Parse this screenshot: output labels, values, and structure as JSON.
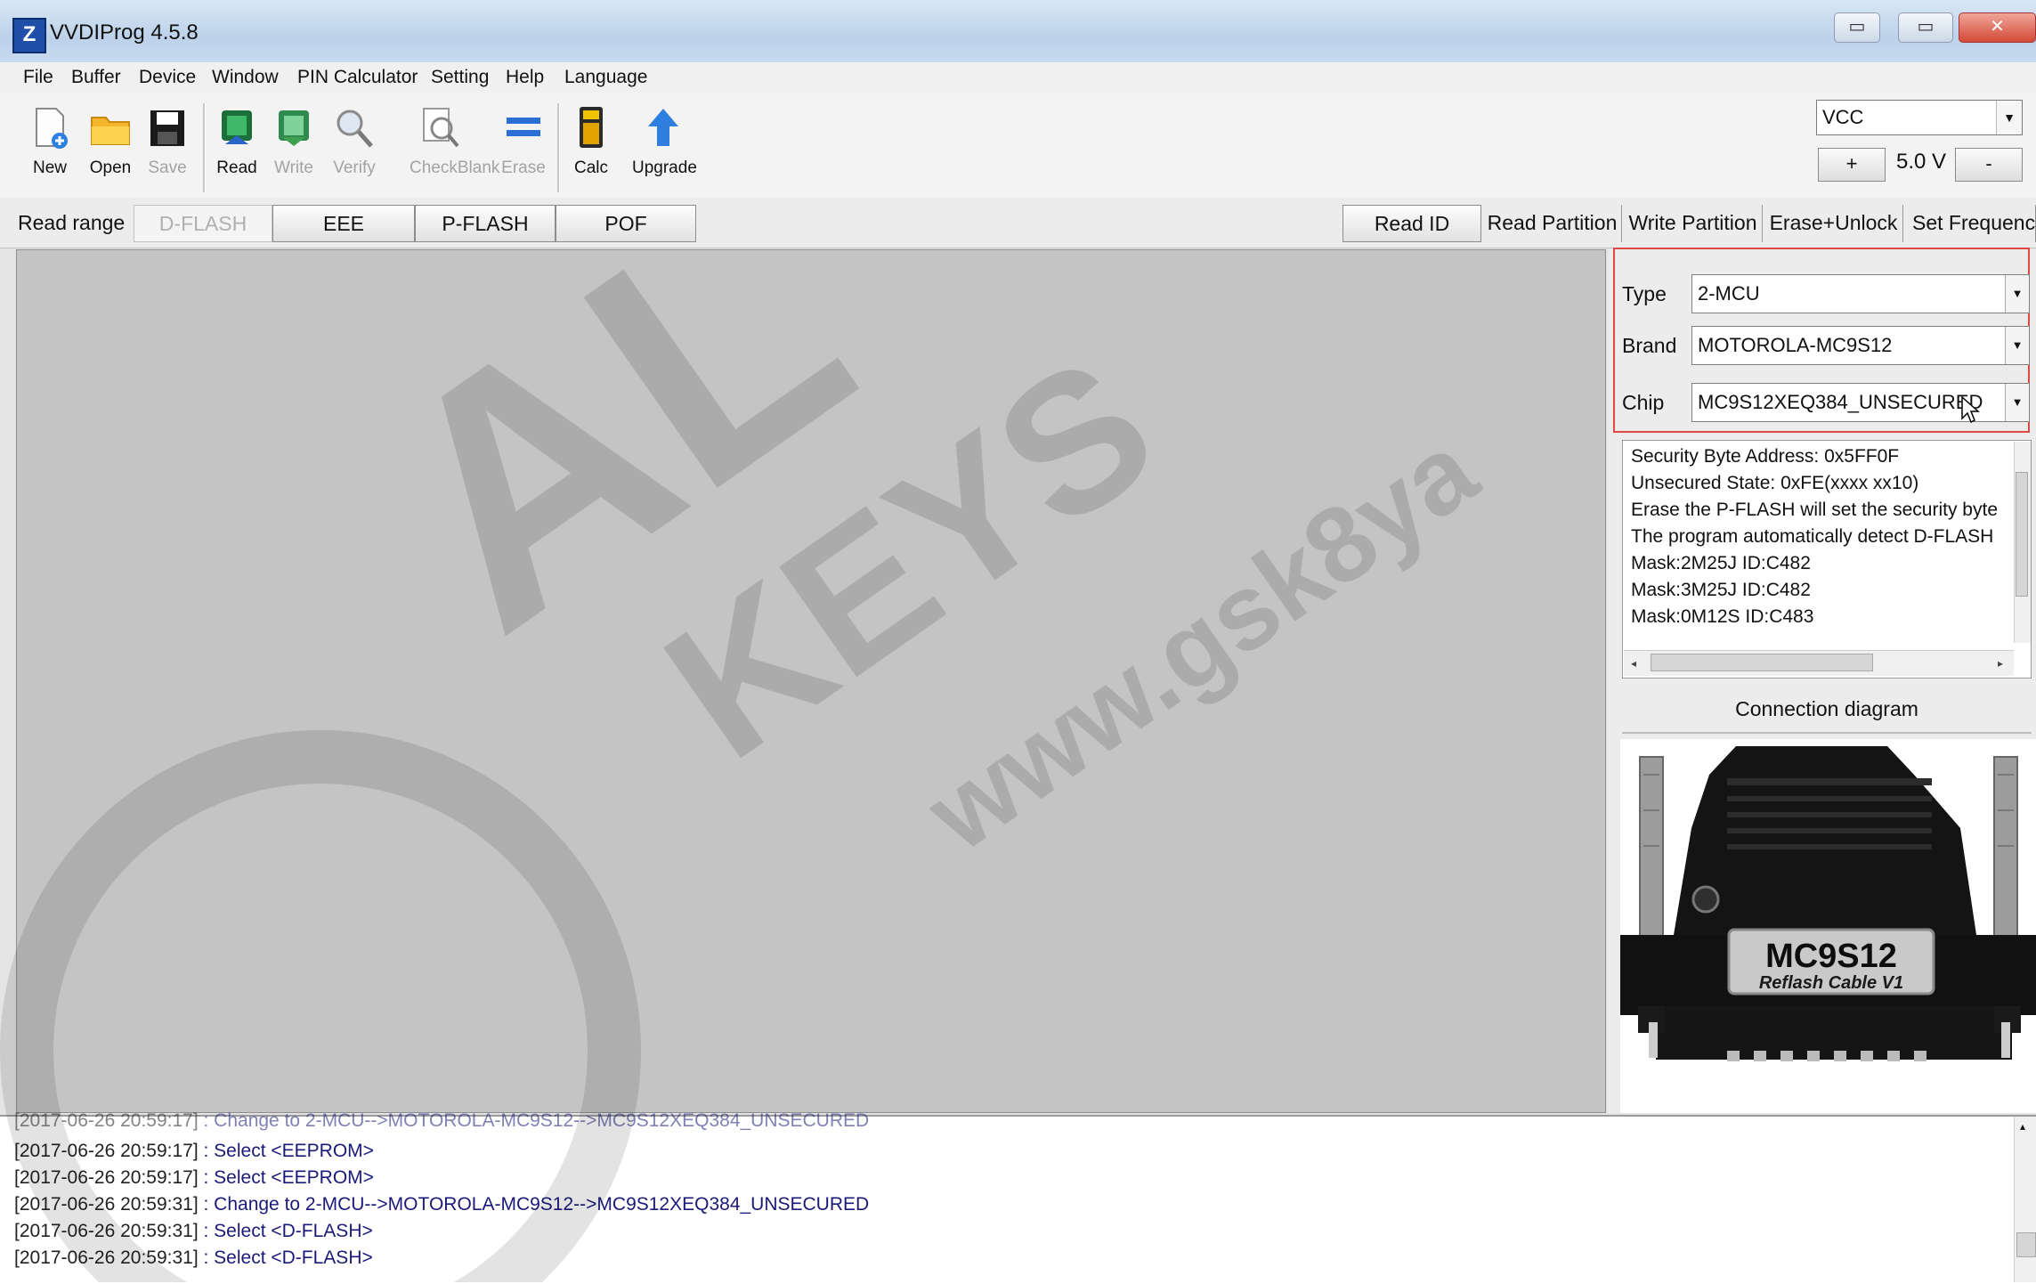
{
  "window": {
    "title": "VVDIProg 4.5.8",
    "minimize_label": "▭",
    "maximize_label": "▭",
    "close_label": "✕"
  },
  "menu": [
    "File",
    "Buffer",
    "Device",
    "Window",
    "PIN Calculator",
    "Setting",
    "Help",
    "Language"
  ],
  "toolbar": {
    "new": "New",
    "open": "Open",
    "save": "Save",
    "read": "Read",
    "write": "Write",
    "verify": "Verify",
    "checkblank": "CheckBlank",
    "erase": "Erase",
    "calc": "Calc",
    "upgrade": "Upgrade",
    "icons": {
      "new": "new-file-icon",
      "open": "folder-icon",
      "save": "floppy-icon",
      "read": "chip-read-icon",
      "write": "chip-write-icon",
      "verify": "magnifier-icon",
      "checkblank": "magnifier-page-icon",
      "erase": "erase-icon",
      "calc": "calculator-icon",
      "upgrade": "up-arrow-icon"
    }
  },
  "vcc": {
    "selected": "VCC",
    "plus": "+",
    "value": "5.0 V",
    "minus": "-"
  },
  "read_range": {
    "label": "Read range",
    "buttons": [
      "D-FLASH",
      "EEE",
      "P-FLASH",
      "POF"
    ],
    "actions": [
      "Read ID",
      "Read Partition",
      "Write Partition",
      "Erase+Unlock",
      "Set Frequency"
    ]
  },
  "selector": {
    "type_label": "Type",
    "type_value": "2-MCU",
    "brand_label": "Brand",
    "brand_value": "MOTOROLA-MC9S12",
    "chip_label": "Chip",
    "chip_value": "MC9S12XEQ384_UNSECURED"
  },
  "info": [
    "Security Byte Address: 0x5FF0F",
    "Unsecured State: 0xFE(xxxx xx10)",
    "Erase the P-FLASH will set the security byte",
    "The program automatically detect D-FLASH",
    "Mask:2M25J ID:C482",
    "Mask:3M25J ID:C482",
    "Mask:0M12S ID:C483"
  ],
  "connection": {
    "label": "Connection diagram",
    "cable_title": "MC9S12",
    "cable_subtitle": "Reflash Cable V1"
  },
  "log": [
    {
      "ts": "[2017-06-26 20:59:17]",
      "msg": " : Change to 2-MCU-->MOTOROLA-MC9S12-->MC9S12XEQ384_UNSECURED"
    },
    {
      "ts": "[2017-06-26 20:59:17]",
      "msg": " : Select <EEPROM>"
    },
    {
      "ts": "[2017-06-26 20:59:17]",
      "msg": " : Select <EEPROM>"
    },
    {
      "ts": "[2017-06-26 20:59:31]",
      "msg": " : Change to 2-MCU-->MOTOROLA-MC9S12-->MC9S12XEQ384_UNSECURED"
    },
    {
      "ts": "[2017-06-26 20:59:31]",
      "msg": " : Select <D-FLASH>"
    },
    {
      "ts": "[2017-06-26 20:59:31]",
      "msg": " : Select <D-FLASH>"
    }
  ],
  "watermark": {
    "big": "AL",
    "keys": "KEYS",
    "url": "www.gsk8ya"
  }
}
